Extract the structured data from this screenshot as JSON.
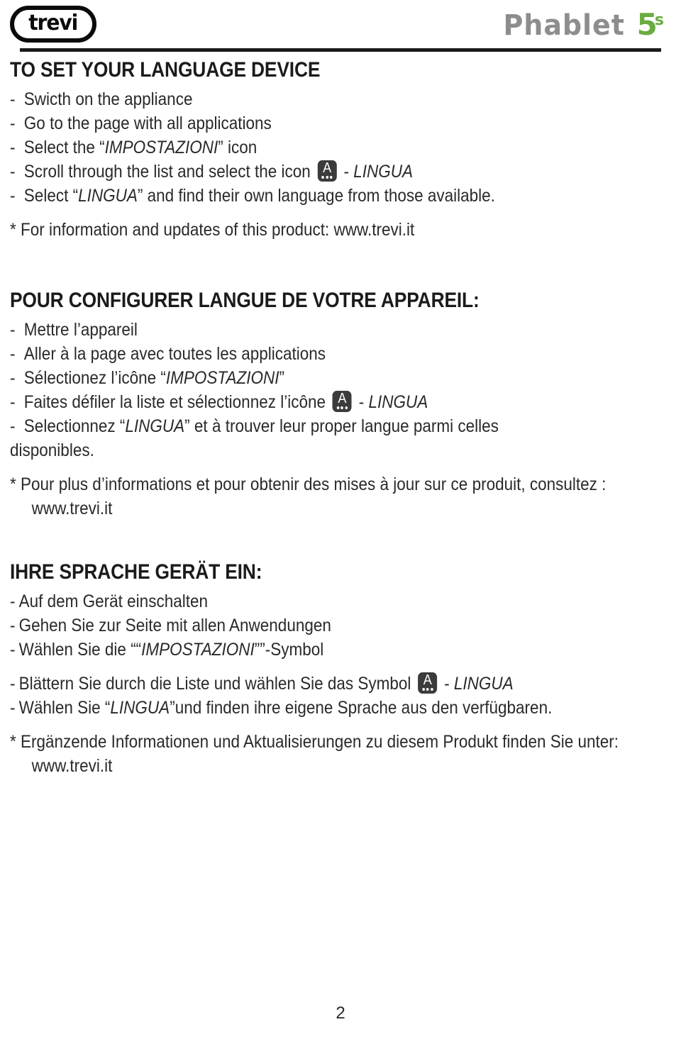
{
  "header": {
    "brand": "trevi",
    "product_name": "Phablet",
    "product_model": "5",
    "product_model_sup": "s",
    "brand_color": "#0b0b0b",
    "product_name_color": "#8d8d8d",
    "product_model_color": "#6aab3f"
  },
  "icon": {
    "name": "lingua-icon",
    "glyph": "A",
    "background_color": "#3b3b3b",
    "foreground_color": "#ffffff"
  },
  "sections": [
    {
      "lang": "en",
      "title": "TO SET YOUR LANGUAGE DEVICE",
      "items": [
        {
          "dash": "-",
          "text": "Swicth on the appliance"
        },
        {
          "dash": "-",
          "text": "Go to the page with all applications"
        },
        {
          "dash": "-",
          "pre": "Select the “",
          "italic": "IMPOSTAZIONI",
          "post": "” icon"
        },
        {
          "dash": "-",
          "pre": "Scroll through the list and select the icon ",
          "has_icon": true,
          "post_icon_pre": " - ",
          "italic_after": "LINGUA"
        },
        {
          "dash": "-",
          "pre": "Select “",
          "italic": "LINGUA",
          "post": "” and find their own language from those available."
        }
      ],
      "note": "* For information and updates of this product: www.trevi.it",
      "note_continuation": ""
    },
    {
      "lang": "fr",
      "title": "POUR CONFIGURER LANGUE DE VOTRE APPAREIL:",
      "items": [
        {
          "dash": "-",
          "text": "Mettre l’appareil"
        },
        {
          "dash": "-",
          "text": "Aller à la page avec toutes les applications"
        },
        {
          "dash": "-",
          "pre": "Sélectionez l’icône “",
          "italic": "IMPOSTAZIONI",
          "post": "”"
        },
        {
          "dash": "-",
          "pre": "Faites défiler la liste et sélectionnez l’icône ",
          "has_icon": true,
          "post_icon_pre": " - ",
          "italic_after": "LINGUA"
        },
        {
          "dash": "-",
          "pre": "Selectionnez “",
          "italic": "LINGUA",
          "post": "” et à trouver leur proper langue parmi celles"
        },
        {
          "dash": "",
          "text": "disponibles."
        }
      ],
      "note": "* Pour plus d’informations et pour obtenir des mises à jour sur ce produit, consultez :",
      "note_continuation": "www.trevi.it"
    },
    {
      "lang": "de",
      "title": "IHRE SPRACHE GERÄT EIN:",
      "items": [
        {
          "dash": "-",
          "text": "Auf dem Gerät einschalten"
        },
        {
          "dash": "-",
          "text": "Gehen Sie zur Seite mit allen Anwendungen"
        },
        {
          "dash": "-",
          "pre": "Wählen Sie die ““",
          "italic": "IMPOSTAZIONI",
          "post": "””-Symbol"
        },
        {
          "dash": "-",
          "pre": "Blättern Sie durch die Liste und wählen Sie das Symbol ",
          "has_icon": true,
          "post_icon_pre": " - ",
          "italic_after": "LINGUA"
        },
        {
          "dash": "-",
          "pre": "Wählen Sie “",
          "italic": "LINGUA",
          "post": "”und finden ihre eigene Sprache aus den verfügbaren."
        }
      ],
      "note": "* Ergänzende Informationen und Aktualisierungen zu diesem Produkt finden Sie unter:",
      "note_continuation": "www.trevi.it"
    }
  ],
  "footer": {
    "page_number": "2"
  }
}
